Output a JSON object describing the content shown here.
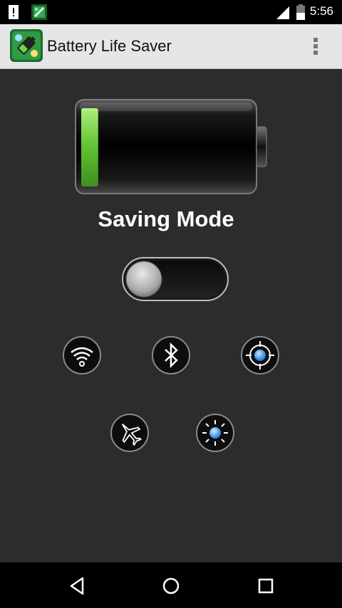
{
  "status_bar": {
    "time": "5:56",
    "icons": [
      "alert-icon",
      "app-notification-icon",
      "signal-icon",
      "battery-status-icon"
    ]
  },
  "action_bar": {
    "title": "Battery Life Saver",
    "logo_icon": "battery-app-logo-icon",
    "overflow_icon": "overflow-menu-icon"
  },
  "main": {
    "battery_level_fraction": 0.1,
    "mode_label": "Saving Mode",
    "saving_mode_on": false,
    "features": [
      {
        "name": "wifi",
        "icon": "wifi-icon"
      },
      {
        "name": "bluetooth",
        "icon": "bluetooth-icon"
      },
      {
        "name": "gps",
        "icon": "gps-icon"
      },
      {
        "name": "airplane",
        "icon": "airplane-icon"
      },
      {
        "name": "brightness",
        "icon": "brightness-icon"
      }
    ]
  },
  "nav_bar": {
    "icons": [
      "back-icon",
      "home-icon",
      "recents-icon"
    ]
  },
  "colors": {
    "background": "#2b2c2e",
    "battery_fill": "#7bd34a",
    "accent_blue": "#2f8fff",
    "action_bar": "#e6e6e6"
  }
}
